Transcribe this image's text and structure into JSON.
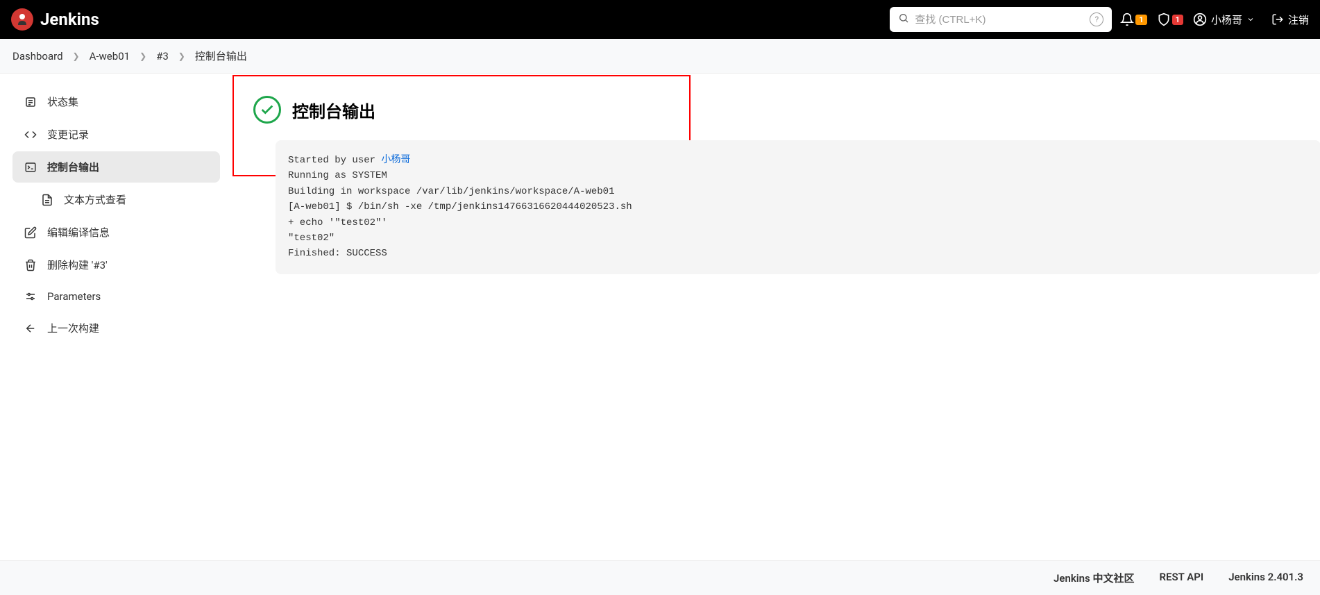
{
  "header": {
    "logo_text": "Jenkins",
    "search_placeholder": "查找 (CTRL+K)",
    "notification_count": "1",
    "security_count": "1",
    "username": "小杨哥",
    "logout": "注销"
  },
  "breadcrumbs": {
    "items": [
      "Dashboard",
      "A-web01",
      "#3"
    ],
    "current": "控制台输出"
  },
  "sidebar": {
    "items": [
      {
        "label": "状态集",
        "icon": "status"
      },
      {
        "label": "变更记录",
        "icon": "changes"
      },
      {
        "label": "控制台输出",
        "icon": "console",
        "active": true
      },
      {
        "label": "文本方式查看",
        "icon": "text",
        "indented": true
      },
      {
        "label": "编辑编译信息",
        "icon": "edit"
      },
      {
        "label": "删除构建 '#3'",
        "icon": "delete"
      },
      {
        "label": "Parameters",
        "icon": "params"
      },
      {
        "label": "上一次构建",
        "icon": "back"
      }
    ]
  },
  "page": {
    "title": "控制台输出"
  },
  "console": {
    "line1_prefix": "Started by user ",
    "line1_link": "小杨哥",
    "line2": "Running as SYSTEM",
    "line3": "Building in workspace /var/lib/jenkins/workspace/A-web01",
    "line4": "[A-web01] $ /bin/sh -xe /tmp/jenkins14766316620444020523.sh",
    "line5": "+ echo '\"test02\"'",
    "line6": "\"test02\"",
    "line7": "Finished: SUCCESS"
  },
  "footer": {
    "link1": "Jenkins 中文社区",
    "link2": "REST API",
    "link3": "Jenkins 2.401.3"
  }
}
